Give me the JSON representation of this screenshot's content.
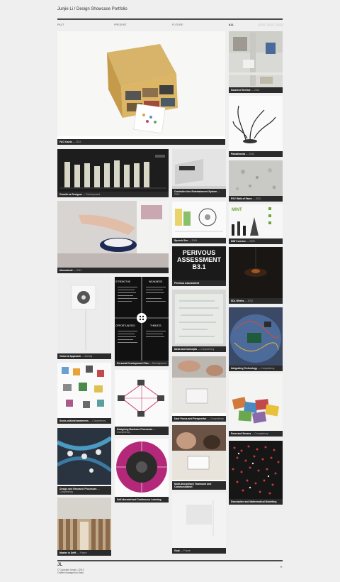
{
  "site": {
    "title": "Junjie Li / Design Showcase Portfolio"
  },
  "nav": [
    {
      "label": "PAST"
    },
    {
      "label": "PRESENT"
    },
    {
      "label": "FUTURE"
    },
    {
      "label": "ALL"
    }
  ],
  "tiles": [
    {
      "title": "FAO Cards",
      "sub": "— 2012"
    },
    {
      "title": "Sound of Service",
      "sub": "— 2012"
    },
    {
      "title": "Panadeonda",
      "sub": "— 2012"
    },
    {
      "title": "Growth as Designer",
      "sub": "— Development"
    },
    {
      "title": "Controller-free Entertainment System",
      "sub": "— 2010"
    },
    {
      "title": "PSV Walk of Fame",
      "sub": "— 2010"
    },
    {
      "title": "Speech Sim",
      "sub": "— 2009"
    },
    {
      "title": "MINT service",
      "sub": "— 2009"
    },
    {
      "title": "Momodroid",
      "sub": "— 2011"
    },
    {
      "title": "Pervious Assessment",
      "sub": ""
    },
    {
      "title": "Vision & Approach",
      "sub": "— Identity"
    },
    {
      "title": "Personal Development Plan",
      "sub": "— Development"
    },
    {
      "title": "Ideas and Concepts",
      "sub": "— Competency"
    },
    {
      "title": "SDL Weeks",
      "sub": "— 2012"
    },
    {
      "title": "Integrating Technology",
      "sub": "— Competency"
    },
    {
      "title": "Socio-cultural awareness",
      "sub": "— Competency"
    },
    {
      "title": "Designing Business Processes",
      "sub": "— Competency"
    },
    {
      "title": "User Focus and Perspective",
      "sub": "— Competency"
    },
    {
      "title": "Form and Senses",
      "sub": "— Competency"
    },
    {
      "title": "Design and Research Processes",
      "sub": "— Competency"
    },
    {
      "title": "Self-directed and Continuous Learning",
      "sub": ""
    },
    {
      "title": "Multi-disciplinary Teamwork and Communication",
      "sub": ""
    },
    {
      "title": "Descriptive and Mathematical Modelling",
      "sub": ""
    },
    {
      "title": "Master in Delft",
      "sub": "— Future"
    },
    {
      "title": "Goal",
      "sub": "— Future"
    }
  ],
  "tile_text": {
    "pervious_line1": "PERIVOUS",
    "pervious_line2": "ASSESSMENT",
    "pervious_line3": "B3.1",
    "swot_weakness": "WEAKNESS",
    "swot_threats": "THREATS",
    "swot_strengths": "STRENGTHS",
    "swot_opportunities": "OPPORTUNITIES",
    "mint_logo": "MINT"
  },
  "footer": {
    "logo": "JL",
    "copyright": "© Copyright Junjie Li 2013",
    "credit": "Crafted managed by Base",
    "to_top": "⌃"
  }
}
